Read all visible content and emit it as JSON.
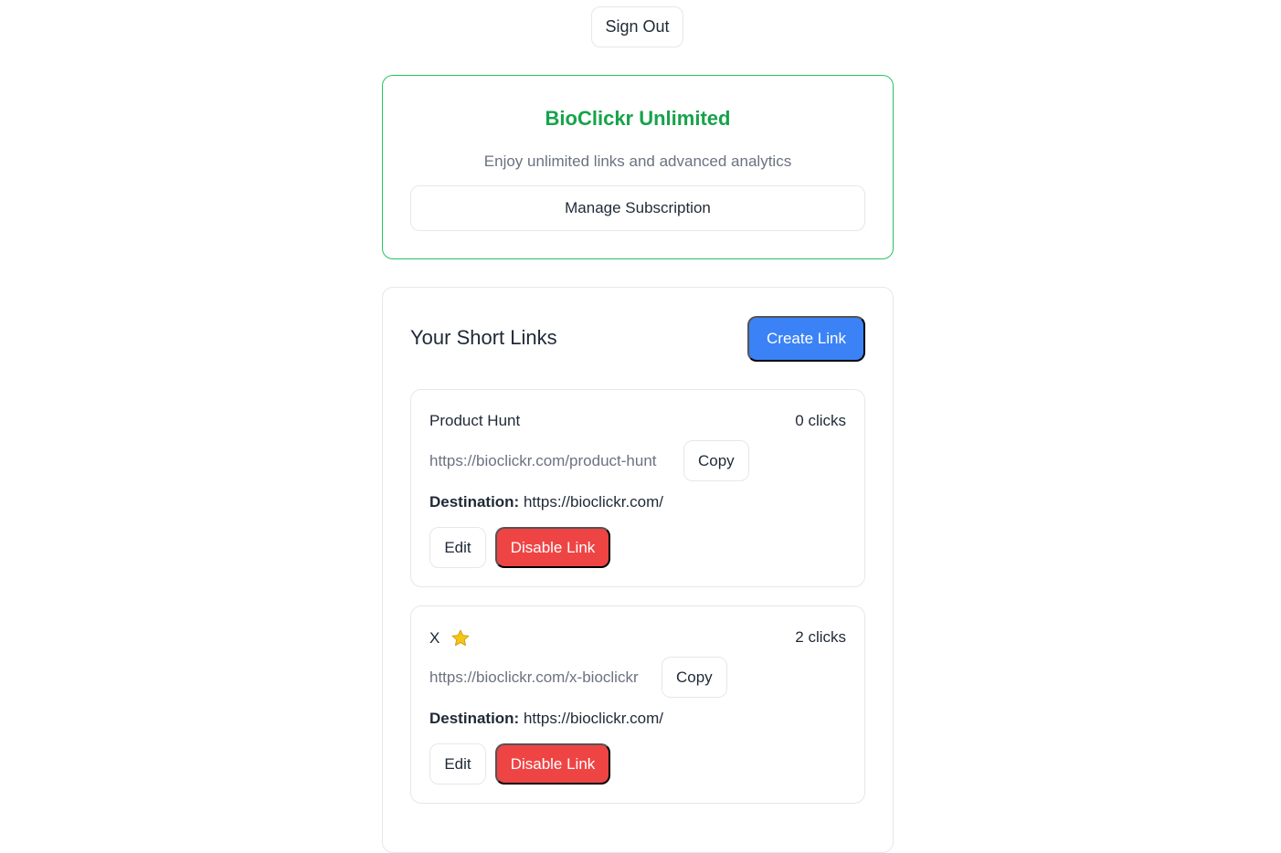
{
  "header": {
    "signout_label": "Sign Out"
  },
  "subscription": {
    "title": "BioClickr Unlimited",
    "description": "Enjoy unlimited links and advanced analytics",
    "manage_label": "Manage Subscription"
  },
  "links": {
    "title": "Your Short Links",
    "create_label": "Create Link",
    "items": [
      {
        "name": "Product Hunt",
        "clicks": "0 clicks",
        "short_url": "https://bioclickr.com/product-hunt",
        "copy_label": "Copy",
        "destination_label": "Destination:",
        "destination": "https://bioclickr.com/",
        "edit_label": "Edit",
        "disable_label": "Disable Link",
        "icon": ""
      },
      {
        "name": "X",
        "clicks": "2 clicks",
        "short_url": "https://bioclickr.com/x-bioclickr",
        "copy_label": "Copy",
        "destination_label": "Destination:",
        "destination": "https://bioclickr.com/",
        "edit_label": "Edit",
        "disable_label": "Disable Link",
        "icon": "star-icon"
      }
    ]
  },
  "colors": {
    "accent_blue": "#3b82f6",
    "danger_red": "#ef4444",
    "success_green": "#16a34a",
    "star_gold": "#f5c518"
  }
}
